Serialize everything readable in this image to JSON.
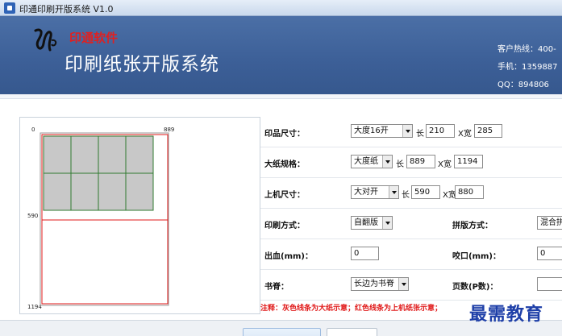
{
  "window": {
    "title": "印通印刷开版系统 V1.0"
  },
  "header": {
    "brand": "印通软件",
    "app_title": "印刷纸张开版系统",
    "contact": {
      "hotline": "客户热线：400-",
      "mobile": "手机：1359887",
      "qq": "QQ：894806"
    }
  },
  "preview": {
    "axis_top_left": "0",
    "axis_top_right": "889",
    "axis_mid": "590",
    "axis_bottom": "1194"
  },
  "form": {
    "print_size": {
      "label": "印品尺寸：",
      "value": "大度16开",
      "length_label": "长",
      "length": "210",
      "width_label": "X宽",
      "width": "285"
    },
    "paper_spec": {
      "label": "大纸规格：",
      "value": "大度纸",
      "length_label": "长",
      "length": "889",
      "width_label": "X宽",
      "width": "1194"
    },
    "machine_size": {
      "label": "上机尺寸：",
      "value": "大对开",
      "length_label": "长",
      "length": "590",
      "width_label": "X宽",
      "width": "880"
    },
    "print_method": {
      "label": "印刷方式：",
      "value": "自翻版"
    },
    "imposition": {
      "label": "拼版方式：",
      "value": "混合拼"
    },
    "bleed": {
      "label": "出血(mm)：",
      "value": "0"
    },
    "gripper": {
      "label": "咬口(mm)：",
      "value": "0"
    },
    "spine": {
      "label": "书脊：",
      "value": "长边为书脊"
    },
    "pages": {
      "label": "页数(P数)：",
      "value": ""
    },
    "note": "注释：灰色线条为大纸示意；红色线条为上机纸张示意；"
  },
  "watermark": "最需教育",
  "colors": {
    "banner": "#3c5f97",
    "machine_sheet_line": "#e01818",
    "small_piece_fill": "#c8c8c8"
  }
}
